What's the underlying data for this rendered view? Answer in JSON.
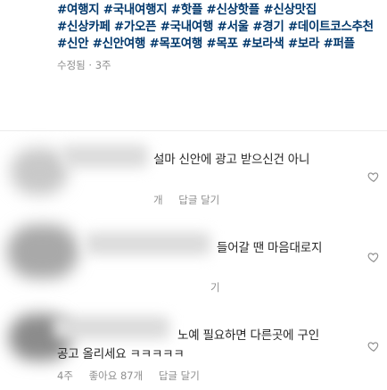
{
  "caption": {
    "hashtag_lines": [
      "#여행지 #국내여행지 #핫플 #신상핫플 #신상맛집",
      "#신상카페 #가오픈 #국내여행 #서울 #경기 #데이트코스추천",
      "#신안 #신안여행 #목포여행 #목포 #보라색 #보라 #퍼플"
    ],
    "edited_meta": "수정됨 · 3주"
  },
  "comments": [
    {
      "text": "설마 신안에 광고 받으신건 아니",
      "meta_partial": "개",
      "reply_label": "답글 달기"
    },
    {
      "text": "들어갈 땐 마음대로지",
      "meta_partial": "기"
    },
    {
      "text_line1": "노예 필요하면 다른곳에 구인",
      "text_line2": "공고 올리세요 ㅋㅋㅋㅋㅋ",
      "time": "4주",
      "likes": "좋아요 87개",
      "reply_label": "답글 달기"
    }
  ],
  "icons": {
    "like": "heart-outline-icon"
  }
}
